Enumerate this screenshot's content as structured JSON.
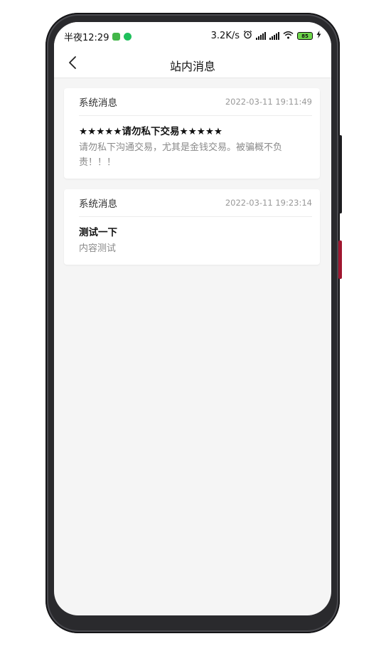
{
  "status_bar": {
    "time": "半夜12:29",
    "network_speed": "3.2K/s",
    "battery_level": "85",
    "icons": [
      "app-notification-icon",
      "wechat-icon",
      "alarm-icon",
      "signal-icon",
      "signal-icon",
      "wifi-icon",
      "battery-icon",
      "charging-icon"
    ]
  },
  "nav": {
    "title": "站内消息",
    "back_icon": "chevron-left-icon"
  },
  "messages": [
    {
      "type": "系统消息",
      "time": "2022-03-11 19:11:49",
      "title": "★★★★★请勿私下交易★★★★★",
      "body": "请勿私下沟通交易，尤其是金钱交易。被骗概不负责！！！"
    },
    {
      "type": "系统消息",
      "time": "2022-03-11 19:23:14",
      "title": "测试一下",
      "body": "内容测试"
    }
  ]
}
